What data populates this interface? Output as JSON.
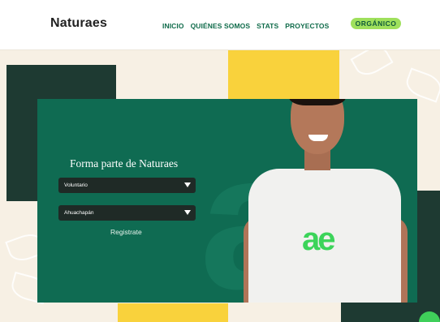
{
  "header": {
    "logo": "Naturaes",
    "nav": [
      "INICIO",
      "QUIÉNES SOMOS",
      "STATS",
      "PROYECTOS"
    ],
    "badge": "ORGÁNICO"
  },
  "form": {
    "title": "Forma parte de Naturaes",
    "select_role": "Voluntario",
    "select_location": "Ahuachapán",
    "register": "Registrate"
  },
  "shirt_logo": "ae",
  "colors": {
    "primary_green": "#0f6b52",
    "dark_green": "#1e3a32",
    "yellow": "#f9d23c",
    "lime": "#9fe05c",
    "cream": "#f7f0e4"
  },
  "icons": [
    "dropdown-arrow-icon",
    "chat-icon"
  ]
}
